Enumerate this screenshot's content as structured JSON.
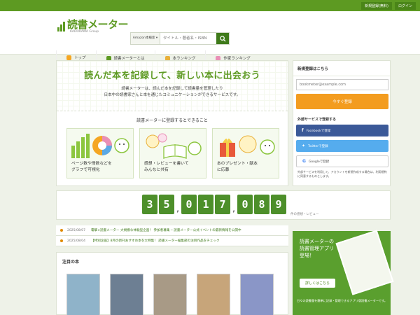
{
  "topbar": {
    "register_label": "新規登録(無料)",
    "login_label": "ログイン"
  },
  "logo": {
    "text": "読書メーター",
    "sub": "KADOKAWA Group"
  },
  "search": {
    "category": "Amazon本検索 ▾",
    "placeholder": "タイトル・著者名・ISBN"
  },
  "nav": [
    {
      "label": "トップ",
      "color": "#f5a623"
    },
    {
      "label": "読書メーターとは",
      "color": "#5d9a22"
    },
    {
      "label": "本ランキング",
      "color": "#e8b03a"
    },
    {
      "label": "作家ランキング",
      "color": "#e98fb6"
    }
  ],
  "hero": {
    "title": "読んだ本を記録して、新しい本に出会おう",
    "desc1": "読書メーターは、読んだ本を記録して読書量を管理したり",
    "desc2": "日本中の読書家さんと本を通じたコミュニケーションができるサービスです。"
  },
  "features_title": "読書メーターに登録するとできること",
  "features": [
    {
      "line1": "ページ数や冊数などを",
      "line2": "グラフで可視化"
    },
    {
      "line1": "感想・レビューを書いて",
      "line2": "みんなと共有"
    },
    {
      "line1": "本のプレゼント・献本",
      "line2": "に応募"
    }
  ],
  "counter": {
    "digits": [
      "3",
      "5",
      ",",
      "0",
      "1",
      "7",
      ",",
      "0",
      "8",
      "9"
    ],
    "label": "件の感想・レビュー"
  },
  "news": [
    {
      "date": "2025/08/07",
      "text": "電撃×読書メーター 大規模な体験型企画！ 参加者募集 ─ 読書メーター公式イベントの最新情報を公開中"
    },
    {
      "date": "2025/08/04",
      "text": "【特別企画】8月の新刊おすすめ本を大特集！ 読書メーター編集部の注目作品をチェック"
    }
  ],
  "notable_title": "注目の本",
  "books": [
    {
      "color": "#8fb3c9"
    },
    {
      "color": "#6d7f93"
    },
    {
      "color": "#a89a86"
    },
    {
      "color": "#c7a57a"
    },
    {
      "color": "#8a96c7"
    }
  ],
  "side": {
    "title": "新規登録はこちら",
    "email_placeholder": "bookmeter@example.com",
    "register_button": "今すぐ登録",
    "ext_title": "外部サービスで登録する",
    "facebook": "Facebookで登録",
    "twitter": "Twitterで登録",
    "google": "Googleで登録",
    "note": "外部サービスを利用して、アカウントを新規作成する場合は、利用規約に同意するものとします。"
  },
  "app": {
    "title1": "読書メーターの",
    "title2": "読書管理アプリ",
    "title3": "登場！",
    "button": "詳しくはこちら",
    "desc": "日々の読書量を簡単に記録・管理できるアプリ版読書メーターです。"
  }
}
